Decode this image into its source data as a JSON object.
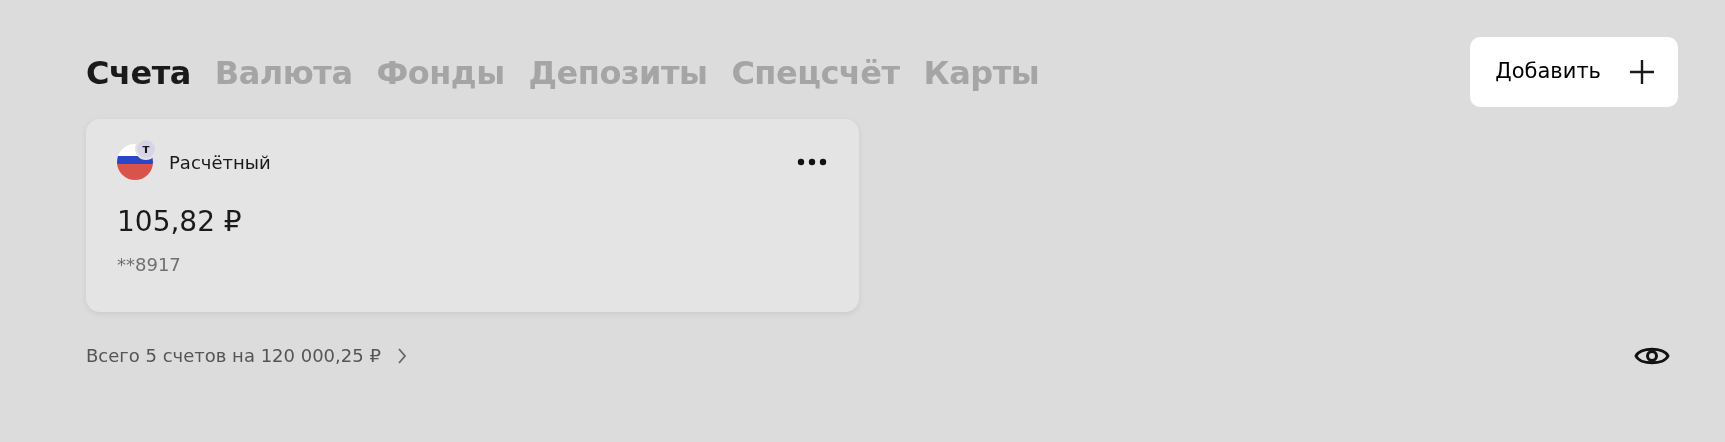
{
  "tabs": [
    {
      "label": "Счета",
      "selected": true
    },
    {
      "label": "Валюта",
      "selected": false
    },
    {
      "label": "Фонды",
      "selected": false
    },
    {
      "label": "Депозиты",
      "selected": false
    },
    {
      "label": "Спецсчёт",
      "selected": false
    },
    {
      "label": "Карты",
      "selected": false
    }
  ],
  "add_button": {
    "label": "Добавить"
  },
  "accounts": [
    {
      "badge": "т",
      "name": "Расчётный",
      "balance": "105,82 ₽",
      "number": "**8917"
    }
  ],
  "summary": {
    "text": "Всего 5 счетов на 120 000,25 ₽"
  }
}
